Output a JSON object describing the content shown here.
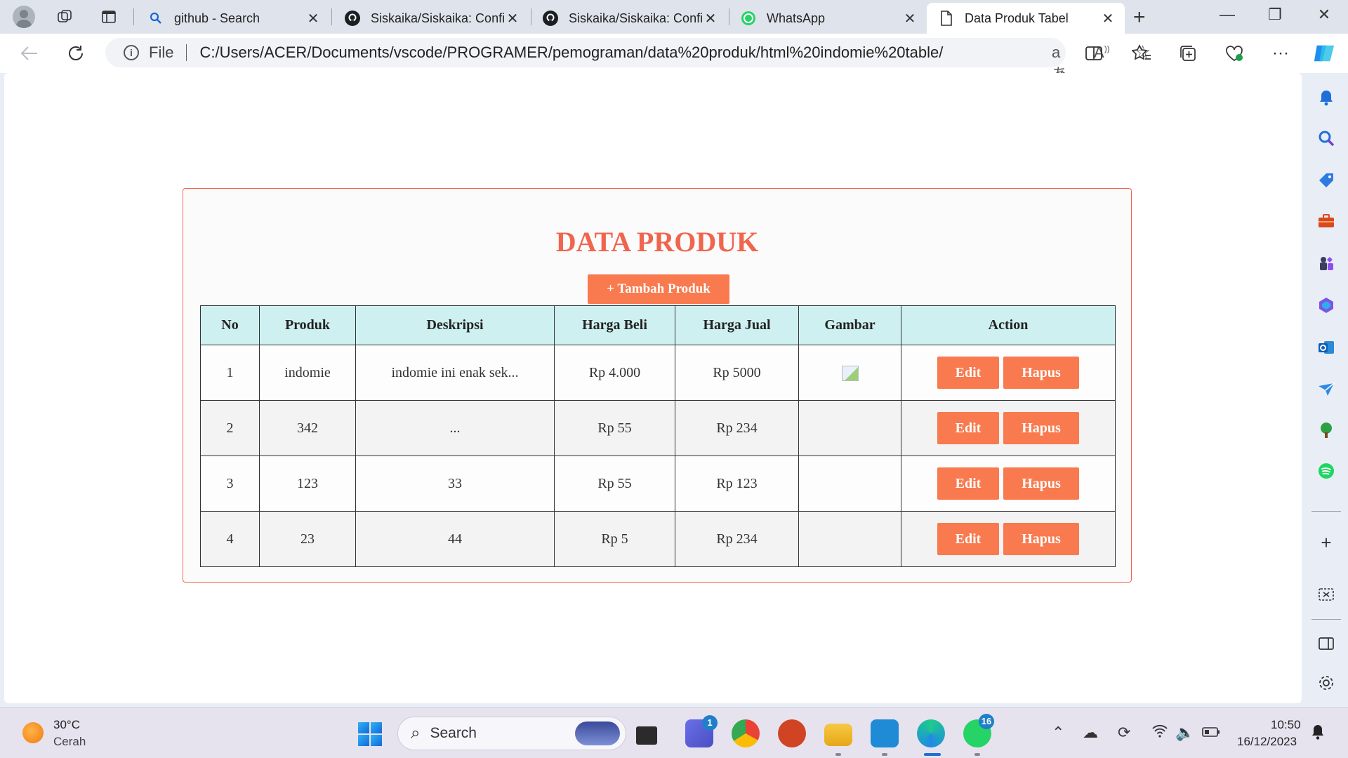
{
  "browser": {
    "tabs": [
      {
        "title": "github - Search",
        "icon": "search-icon"
      },
      {
        "title": "Siskaika/Siskaika: Confi",
        "icon": "github-icon"
      },
      {
        "title": "Siskaika/Siskaika: Confi",
        "icon": "github-icon"
      },
      {
        "title": "WhatsApp",
        "icon": "whatsapp-icon"
      },
      {
        "title": "Data Produk Tabel",
        "icon": "page-icon",
        "active": true
      }
    ],
    "address": {
      "scheme_label": "File",
      "url": "C:/Users/ACER/Documents/vscode/PROGRAMER/pemograman/data%20produk/html%20indomie%20table/ind..."
    }
  },
  "page": {
    "title": "DATA PRODUK",
    "add_button": "+ Tambah Produk",
    "columns": [
      "No",
      "Produk",
      "Deskripsi",
      "Harga Beli",
      "Harga Jual",
      "Gambar",
      "Action"
    ],
    "rows": [
      {
        "no": "1",
        "produk": "indomie",
        "deskripsi": "indomie ini enak sek...",
        "harga_beli": "Rp 4.000",
        "harga_jual": "Rp 5000",
        "has_image": true
      },
      {
        "no": "2",
        "produk": "342",
        "deskripsi": "...",
        "harga_beli": "Rp 55",
        "harga_jual": "Rp 234",
        "has_image": false
      },
      {
        "no": "3",
        "produk": "123",
        "deskripsi": "33",
        "harga_beli": "Rp 55",
        "harga_jual": "Rp 123",
        "has_image": false
      },
      {
        "no": "4",
        "produk": "23",
        "deskripsi": "44",
        "harga_beli": "Rp 5",
        "harga_jual": "Rp 234",
        "has_image": false
      }
    ],
    "edit_label": "Edit",
    "delete_label": "Hapus"
  },
  "taskbar": {
    "weather_temp": "30°C",
    "weather_desc": "Cerah",
    "search_label": "Search",
    "teams_badge": "1",
    "whatsapp_badge": "16",
    "time": "10:50",
    "date": "16/12/2023"
  },
  "colors": {
    "accent": "#f0654d",
    "button": "#f87a4e",
    "table_header": "#cff0f0"
  }
}
